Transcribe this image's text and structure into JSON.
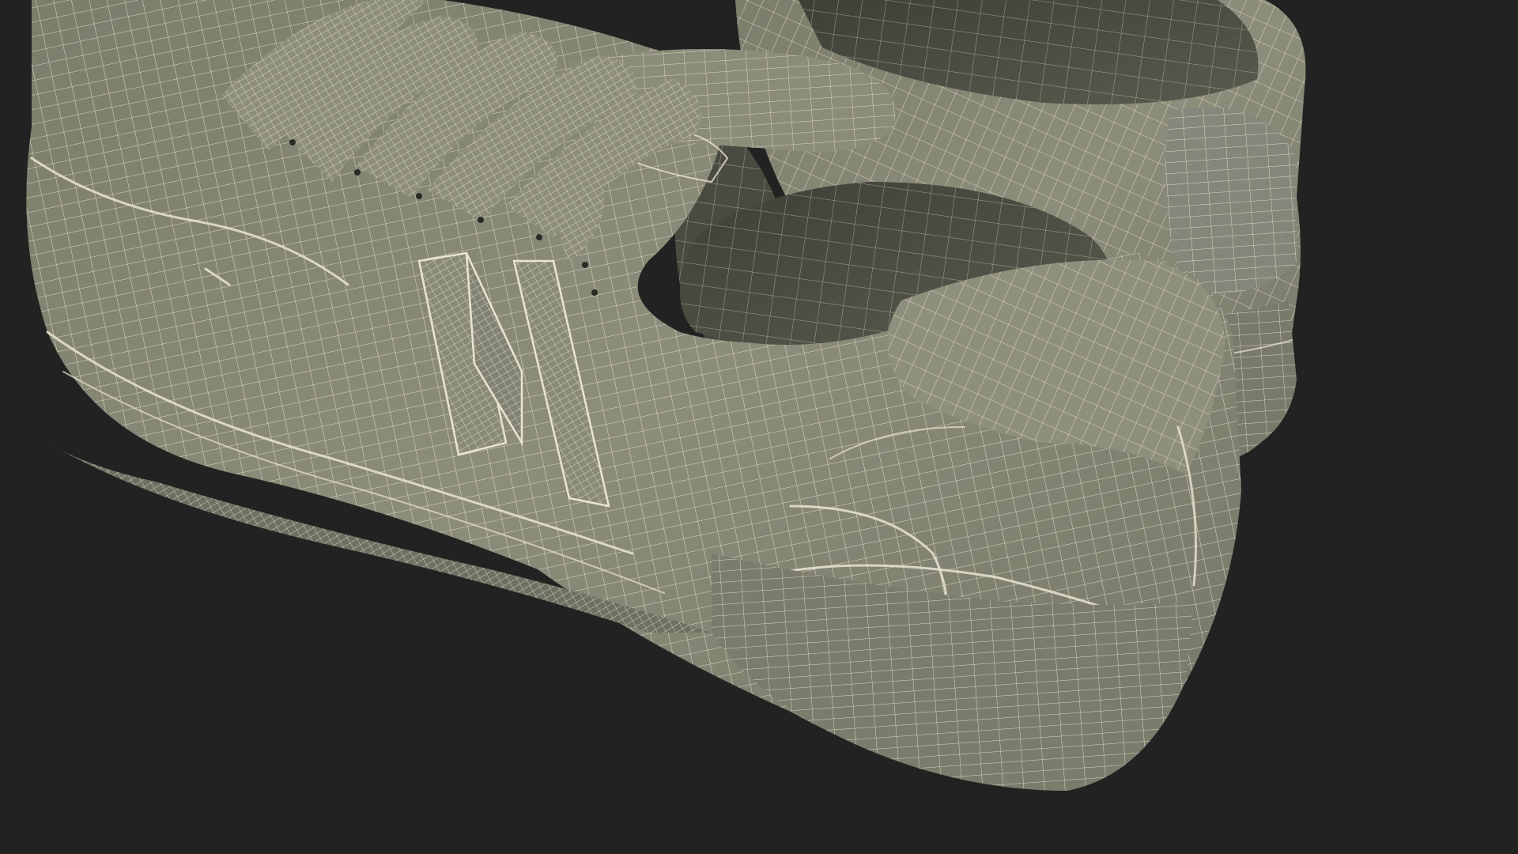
{
  "scene": {
    "subject": "wireframe-sneaker-pair",
    "view": "rear-three-quarter-closeup",
    "render_mode": "shaded-wireframe"
  },
  "colors": {
    "background": "#222222",
    "shell_fill": "#8a8a78",
    "shell_shadow": "#5f5f52",
    "shell_highlight": "#a3a392",
    "interior_fill": "#4d4d43",
    "wire_color": "#e8e6d2"
  }
}
